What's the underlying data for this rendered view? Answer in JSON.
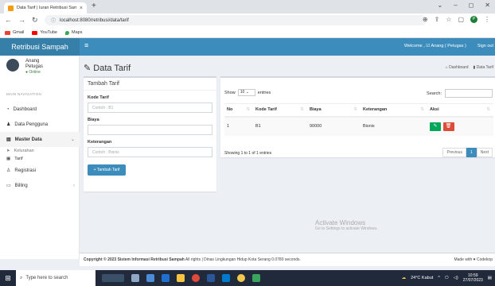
{
  "browser": {
    "tab_title": "Data Tarif | Iuran Retribusi Samp...",
    "url": "localhost:8080/retribusi/data/tarif",
    "bookmarks": [
      {
        "label": "Gmail",
        "color": "#ea4335"
      },
      {
        "label": "YouTube",
        "color": "#ff0000"
      },
      {
        "label": "Maps",
        "color": "#34a853"
      }
    ]
  },
  "app": {
    "logo": "Retribusi Sampah",
    "welcome": "Welcome , ☑ Anang ( Petugas )",
    "signout": "Sign out",
    "accent": "#3c8dbc"
  },
  "user": {
    "name_line1": "Anang",
    "name_line2": "Petugas",
    "status": "● Online"
  },
  "sidebar": {
    "nav_header": "MAIN NAVIGATION",
    "items": [
      {
        "label": "Dashboard",
        "icon": "dashboard-icon"
      },
      {
        "label": "Data Pengguna",
        "icon": "user-icon"
      },
      {
        "label": "Master Data",
        "icon": "book-icon"
      },
      {
        "label": "Registrasi",
        "icon": "user-plus-icon"
      },
      {
        "label": "Billing",
        "icon": "money-icon"
      }
    ],
    "sub_items": [
      "Kelurahan",
      "Tarif"
    ]
  },
  "page": {
    "title": "Data Tarif",
    "breadcrumb": [
      "Dashboard",
      "Data Tarif"
    ]
  },
  "form": {
    "header": "Tambah Tarif",
    "kode_label": "Kode Tarif",
    "kode_placeholder": "Contoh : B1",
    "biaya_label": "Biaya",
    "biaya_placeholder": "",
    "ket_label": "Keterangan",
    "ket_placeholder": "Contoh : Bisnis",
    "submit": "Tambah Tarif"
  },
  "table": {
    "show": "Show",
    "entries_value": "10",
    "entries": "entries",
    "search_label": "Search:",
    "columns": [
      "No",
      "Kode Tarif",
      "Biaya",
      "Keterangan",
      "Aksi"
    ],
    "rows": [
      {
        "no": "1",
        "kode": "B1",
        "biaya": "90000",
        "ket": "Bisnis"
      }
    ],
    "info": "Showing 1 to 1 of 1 entries",
    "prev": "Previous",
    "page": "1",
    "next": "Next",
    "edit_color": "#00a65a",
    "delete_color": "#dd4b39"
  },
  "watermark": {
    "line1": "Activate Windows",
    "line2": "Go to Settings to activate Windows."
  },
  "footer": {
    "left_bold": "Copyright © 2023 Sistem Informasi Retribusi Sampah",
    "left": " All rights | Dinas Lingkungan Hidup Kota Serang 0.0780 seconds.",
    "right": "Made with ♥ Codekop"
  },
  "taskbar": {
    "search": "Type here to search",
    "weather": "24°C Kabut",
    "time": "10:59",
    "date": "27/07/2023"
  }
}
